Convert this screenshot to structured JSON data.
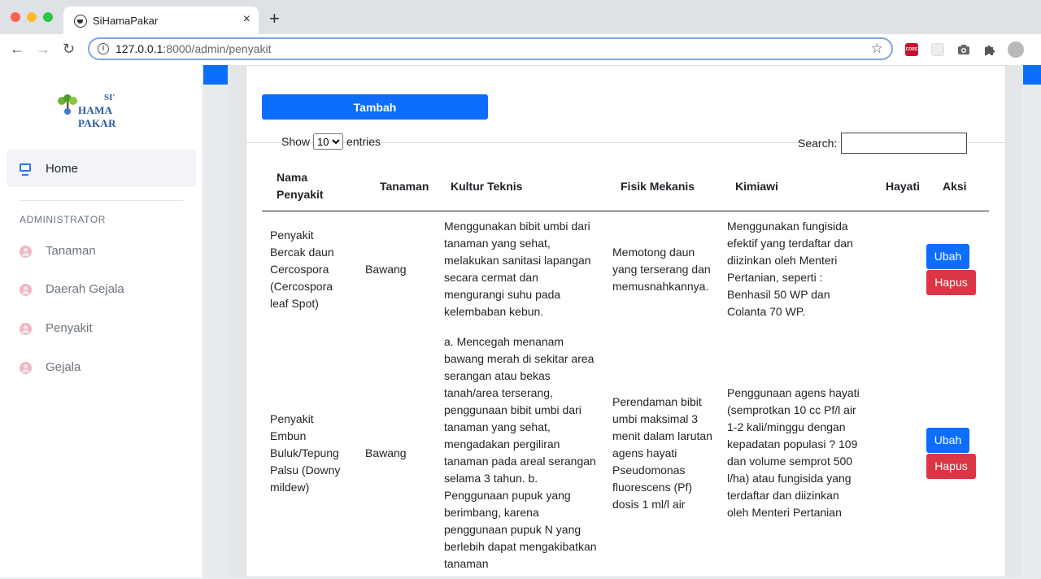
{
  "browser": {
    "tab_title": "SiHamaPakar",
    "tab_close": "×",
    "new_tab": "+",
    "url_host": "127.0.0.1",
    "url_path": ":8000/admin/penyakit",
    "ext_cors_label": "CORS",
    "icons": [
      "back-icon",
      "forward-icon",
      "reload-icon",
      "info-icon",
      "star-icon",
      "camera-icon",
      "puzzle-icon",
      "profile-avatar"
    ]
  },
  "sidebar": {
    "logo_top": "SI'",
    "logo_bottom": "HAMA PAKAR",
    "home": "Home",
    "section": "ADMINISTRATOR",
    "items": [
      {
        "label": "Tanaman"
      },
      {
        "label": "Daerah Gejala"
      },
      {
        "label": "Penyakit"
      },
      {
        "label": "Gejala"
      }
    ]
  },
  "main": {
    "add_button": "Tambah",
    "show_label": "Show",
    "entries_label": "entries",
    "page_size": "10",
    "search_label": "Search:",
    "columns": [
      "Nama Penyakit",
      "Tanaman",
      "Kultur Teknis",
      "Fisik Mekanis",
      "Kimiawi",
      "Hayati",
      "Aksi"
    ],
    "rows": [
      {
        "nama": "Penyakit Bercak daun Cercospora (Cercospora leaf Spot)",
        "tanaman": "Bawang",
        "kultur": "Menggunakan bibit umbi dari tanaman yang sehat, melakukan sanitasi lapangan secara cermat dan mengurangi suhu pada kelembaban kebun.",
        "fisik": "Memotong daun yang terserang dan memusnahkannya.",
        "kimiawi": "Menggunakan fungisida efektif yang terdaftar dan diizinkan oleh Menteri Pertanian, seperti : Benhasil 50 WP dan Colanta 70 WP.",
        "hayati": "",
        "ubah": "Ubah",
        "hapus": "Hapus"
      },
      {
        "nama": "Penyakit Embun Buluk/Tepung Palsu (Downy mildew)",
        "tanaman": "Bawang",
        "kultur": "a. Mencegah menanam bawang merah di sekitar area serangan atau bekas tanah/area terserang, penggunaan bibit umbi dari tanaman yang sehat, mengadakan pergiliran tanaman pada areal serangan selama 3 tahun. b. Penggunaan pupuk yang berimbang, karena penggunaan pupuk N yang berlebih dapat mengakibatkan tanaman",
        "fisik": "Perendaman bibit umbi maksimal 3 menit dalam larutan agens hayati Pseudomonas fluorescens (Pf) dosis 1 ml/l air",
        "kimiawi": "Penggunaan agens hayati (semprotkan 10 cc Pf/l air 1-2 kali/minggu dengan kepadatan populasi ? 109 dan volume semprot 500 l/ha) atau fungisida yang terdaftar dan diizinkan oleh Menteri Pertanian",
        "hayati": "",
        "ubah": "Ubah",
        "hapus": "Hapus"
      }
    ]
  },
  "colors": {
    "primary": "#0d6efd",
    "danger": "#dc3545",
    "nav_icon": "#f5b5c0"
  }
}
